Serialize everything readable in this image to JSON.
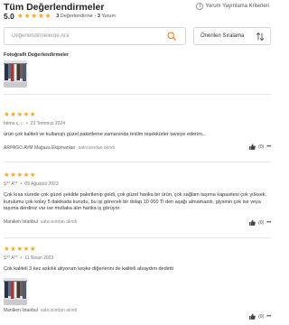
{
  "header": {
    "title": "Tüm Değerlendirmeler",
    "score": "5.0",
    "stars": "★★★★★",
    "rating_count": "3",
    "rating_label": "Değerlendirme",
    "comment_count": "3",
    "comment_label": "Yorum",
    "criteria_label": "Yorum Yayınlama Kriterleri",
    "criteria_icon": "info-icon"
  },
  "search": {
    "placeholder": "Değerlendirmelerde Ara",
    "icon": "search-icon"
  },
  "sort": {
    "selected": "Önerilen Sıralama",
    "icon": "sort-arrows-icon"
  },
  "photo_section": {
    "title": "Fotoğraflı Değerlendirmeler"
  },
  "colors": {
    "star": "#f4a62a",
    "accent": "#f27a1a"
  },
  "reviews": [
    {
      "stars": "★★★★★",
      "author": "fatma ç. ı.",
      "date": "23 Temmuz 2024",
      "text": "ürün çok kaliteli ve kullanışlı güzel paketleme zamanında teslim teşekkürler tavsiye ederim...",
      "seller": "ARPAGO AVM Mağaza Ekipmanları",
      "seller_suffix": "satıcısından alındı",
      "likes": "(0)"
    },
    {
      "stars": "★★★★★",
      "author": "S** A**",
      "date": "09 Ağustos 2023",
      "text": "Çok kısa sürede çok güzel şekilde paketlenip geldi, çok güzel harika bir ürün, çok sağlam taşıma kapasitesi çok yüksek, kurulumu çok kolay 5 dakikada kurudu, bu işi görecek bir dolap 10 000 Tl den aşağı almamazdı, giysinin çok ise veya taşıma derdiniz var ise mutlaka alın harika iş görüyor.",
      "seller": "Maniken İstanbul",
      "seller_suffix": "satıcısından alındı",
      "likes": "(0)"
    },
    {
      "stars": "★★★★★",
      "author": "S** A**",
      "date": "11 Nisan 2023",
      "text": "Çok kaliteli 3 kez askılık aliyorum keşke diğerlerini de kaliteli alsaydım dedirtti",
      "seller": "Maniken İstanbul",
      "seller_suffix": "satıcısından alındı",
      "likes": "(0)"
    }
  ]
}
